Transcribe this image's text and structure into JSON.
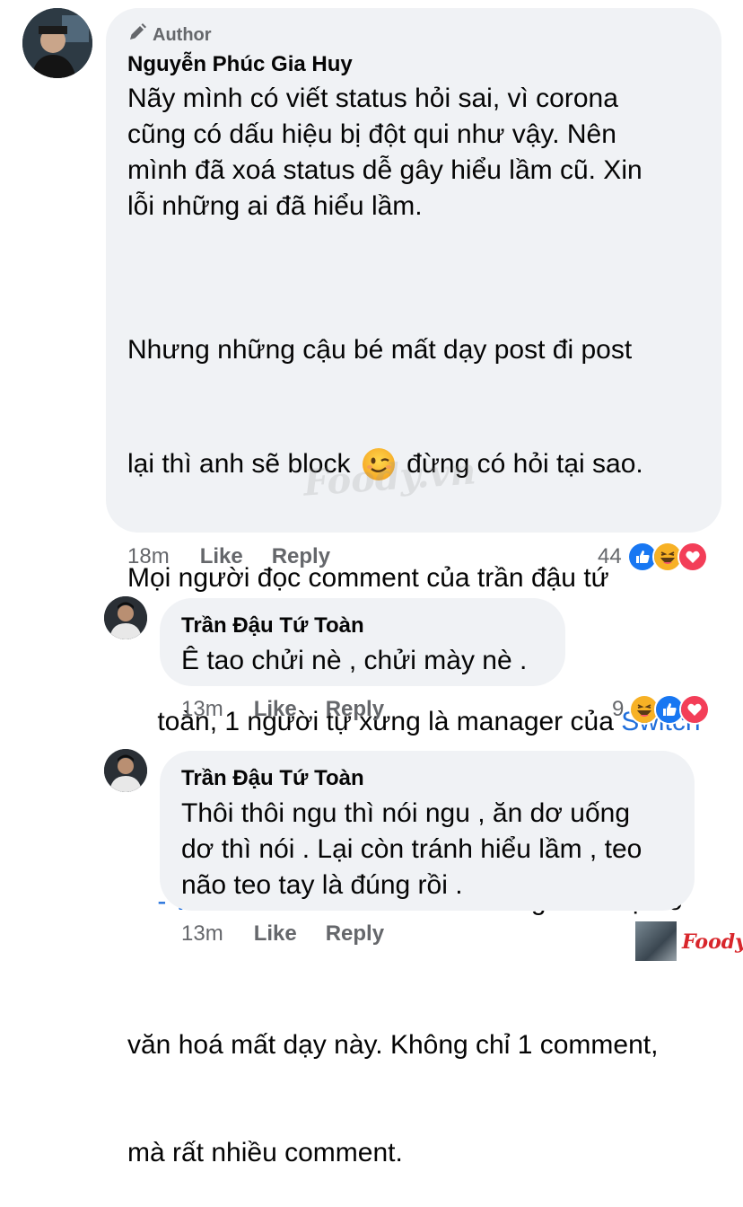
{
  "comment1": {
    "badge": "Author",
    "name": "Nguyễn Phúc Gia Huy",
    "para1": "Nãy mình có viết status hỏi sai, vì corona\ncũng có dấu hiệu bị đột qui như vậy. Nên\nmình đã xoá status dễ gây hiểu lầm cũ. Xin\nlỗi những ai đã hiểu lầm.",
    "para2_line1": "Nhưng những cậu bé mất dạy post đi post",
    "para2_line2_a": "lại thì anh sẽ block ",
    "emoji_wink": "😉",
    "para2_line2_b": " đừng có hỏi tại sao.",
    "para2_line3": "Mọi người đọc comment của trần đậu tứ",
    "para2_line4_a": "toàn, 1 người tự xưng là manager của ",
    "link_part1": "Switch",
    "link_part2": "- Wine & Cocktail Bar",
    "para2_line5_b": " để thường thức sự vô",
    "para2_line6": "văn hoá mất dạy này. Không chỉ 1 comment,",
    "para2_line7": "mà rất nhiều comment.",
    "time": "18m",
    "like": "Like",
    "reply": "Reply",
    "reaction_count": "44"
  },
  "reply1": {
    "name": "Trần Đậu Tứ Toàn",
    "text": "Ê tao chửi nè , chửi mày nè .",
    "time": "13m",
    "like": "Like",
    "reply": "Reply",
    "reaction_count": "9"
  },
  "reply2": {
    "name": "Trần Đậu Tứ Toàn",
    "text": "Thôi thôi ngu thì nói ngu , ăn dơ uống\ndơ thì nói . Lại còn tránh hiểu lầm , teo\nnão teo tay là đúng rồi .",
    "time": "13m",
    "like": "Like",
    "reply": "Reply"
  },
  "watermark": "Foody.vn",
  "brand": "Foody.vn",
  "colors": {
    "bubble": "#f0f2f5",
    "link": "#216fdb",
    "meta": "#65676b",
    "like_blue": "#1877f2",
    "love_red": "#f33e58",
    "haha_yellow": "#f7b125"
  },
  "icons": [
    "pencil-icon",
    "like-reaction-icon",
    "haha-reaction-icon",
    "love-reaction-icon"
  ]
}
